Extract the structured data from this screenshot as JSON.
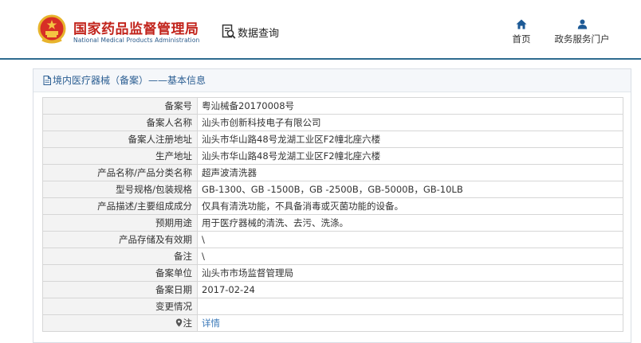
{
  "header": {
    "logo_cn": "国家药品监督管理局",
    "logo_en": "National Medical Products Administration",
    "query_label": "数据查询",
    "nav": [
      {
        "label": "首页",
        "icon": "home-icon"
      },
      {
        "label": "政务服务门户",
        "icon": "user-icon"
      }
    ]
  },
  "panel": {
    "title": "境内医疗器械（备案）——基本信息"
  },
  "rows": [
    {
      "key": "备案号",
      "value": "粤汕械备20170008号"
    },
    {
      "key": "备案人名称",
      "value": "汕头市创新科技电子有限公司"
    },
    {
      "key": "备案人注册地址",
      "value": "汕头市华山路48号龙湖工业区F2幢北座六楼"
    },
    {
      "key": "生产地址",
      "value": "汕头市华山路48号龙湖工业区F2幢北座六楼"
    },
    {
      "key": "产品名称/产品分类名称",
      "value": "超声波清洗器"
    },
    {
      "key": "型号规格/包装规格",
      "value": "GB-1300、GB -1500B，GB -2500B，GB-5000B，GB-10LB"
    },
    {
      "key": "产品描述/主要组成成分",
      "value": "仅具有清洗功能，不具备消毒或灭菌功能的设备。"
    },
    {
      "key": "预期用途",
      "value": "用于医疗器械的清洗、去污、洗涤。"
    },
    {
      "key": "产品存储及有效期",
      "value": "\\"
    },
    {
      "key": "备注",
      "value": "\\"
    },
    {
      "key": "备案单位",
      "value": "汕头市市场监督管理局"
    },
    {
      "key": "备案日期",
      "value": "2017-02-24"
    },
    {
      "key": "变更情况",
      "value": ""
    },
    {
      "key": "注",
      "value": "详情"
    }
  ],
  "colors": {
    "logo_red": "#c2241c",
    "brand_blue": "#2e6b8f",
    "link_blue": "#3a78b8"
  }
}
